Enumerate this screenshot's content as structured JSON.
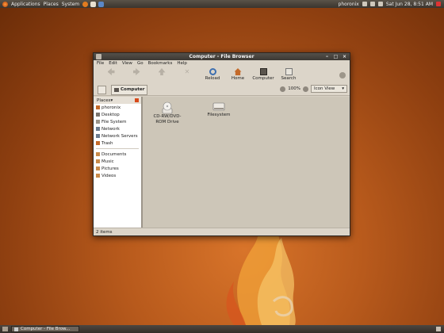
{
  "top_panel": {
    "menus": [
      "Applications",
      "Places",
      "System"
    ],
    "username": "phoronix",
    "clock": "Sat Jun 28,  8:51 AM"
  },
  "window": {
    "title": "Computer - File Browser",
    "menubar": [
      "File",
      "Edit",
      "View",
      "Go",
      "Bookmarks",
      "Help"
    ],
    "toolbar": {
      "reload": "Reload",
      "home": "Home",
      "computer": "Computer",
      "search": "Search"
    },
    "location": {
      "path_button": "Computer",
      "zoom": "100%",
      "view_mode": "Icon View"
    },
    "sidebar": {
      "header": "Places",
      "items": [
        "phoronix",
        "Desktop",
        "File System",
        "Network",
        "Network Servers",
        "Trash"
      ],
      "bookmarks": [
        "Documents",
        "Music",
        "Pictures",
        "Videos"
      ]
    },
    "files": [
      {
        "label": "CD-RW/DVD-ROM Drive",
        "icon": "optical-drive-icon"
      },
      {
        "label": "Filesystem",
        "icon": "hard-drive-icon"
      }
    ],
    "status": "2 items"
  },
  "bottom_panel": {
    "task": "Computer - File Brow..."
  }
}
